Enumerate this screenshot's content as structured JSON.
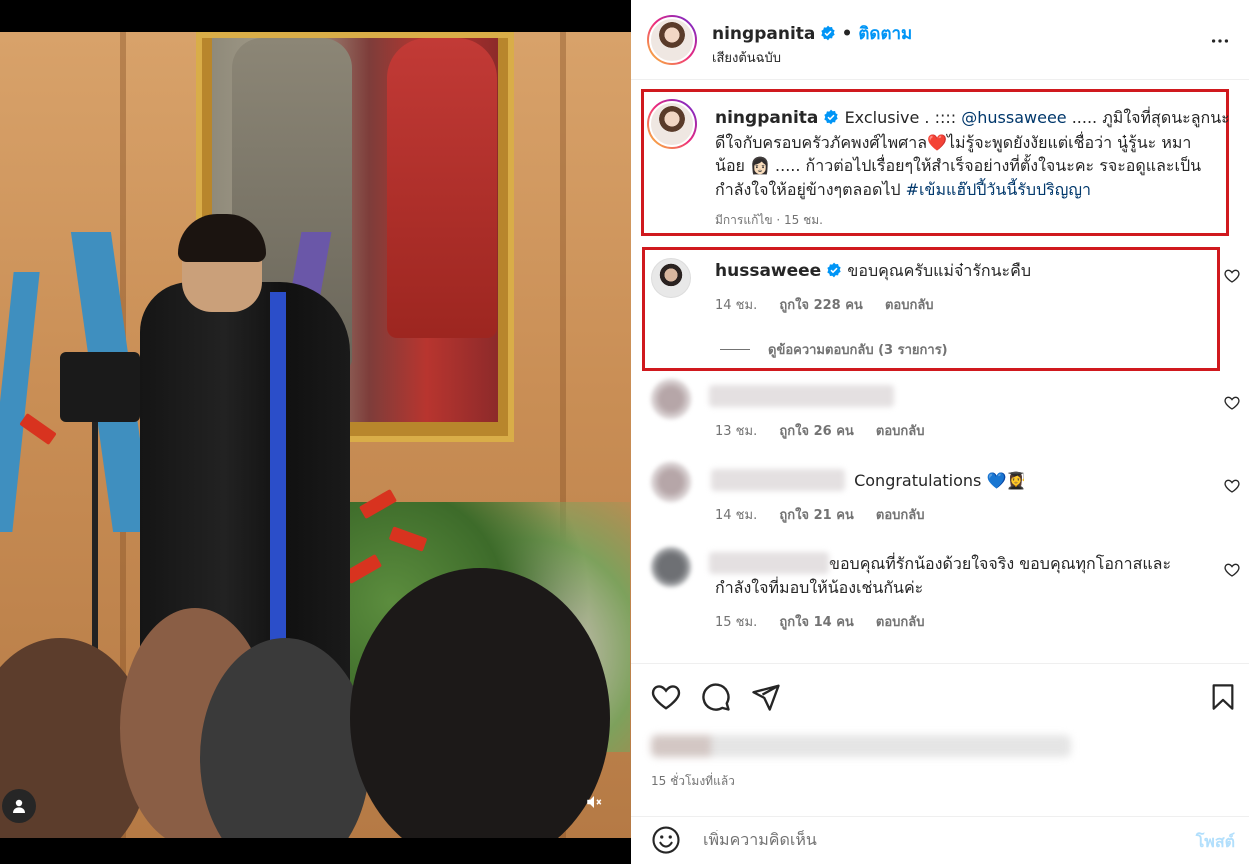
{
  "post": {
    "author": "ningpanita",
    "follow_label": "ติดตาม",
    "subtitle": "เสียงต้นฉบับ",
    "caption": {
      "username": "ningpanita",
      "line1_pre": "Exclusive . :::: ",
      "mention": "@hussaweee",
      "line1_post": " ..... ภูมิใจที่สุดนะลูกนะ",
      "line2_pre": "ดีใจกับครอบครัวภัคพงศ์ไพศาล",
      "line2_emoji": "❤️",
      "line2_post": "ไม่รู้จะพูดยังงัยแต่เชื่อว่า นู๋รู้นะ หมา",
      "line3_pre": "น้อย ",
      "line3_emoji": "👩🏻",
      "line3_post": " ..... ก้าวต่อไปเรื่อยๆให้สำเร็จอย่างที่ตั้งใจนะคะ รจะอดูและเป็น",
      "line4_pre": "กำลังใจให้อยู่ข้างๆตลอดไป ",
      "hashtag": "#เข้มแฮ๊ปปี้วันนี้รับปริญญา",
      "meta": "มีการแก้ไข · 15 ชม."
    },
    "comments": [
      {
        "username": "hussaweee",
        "text": "ขอบคุณครับแม่จ๋ารักนะคืบ",
        "time": "14 ชม.",
        "likes": "ถูกใจ 228 คน",
        "reply": "ตอบกลับ",
        "view_replies": "ดูข้อความตอบกลับ (3 รายการ)"
      },
      {
        "username": "",
        "text": "",
        "time": "13 ชม.",
        "likes": "ถูกใจ 26 คน",
        "reply": "ตอบกลับ"
      },
      {
        "username": "",
        "text": "Congratulations 💙👩‍🎓",
        "time": "14 ชม.",
        "likes": "ถูกใจ 21 คน",
        "reply": "ตอบกลับ"
      },
      {
        "username": "",
        "text_line1": "ขอบคุณที่รักน้องด้วยใจจริง ขอบคุณทุกโอกาสและ",
        "text_line2": "กำลังใจที่มอบให้น้องเช่นกันค่ะ",
        "time": "15 ชม.",
        "likes": "ถูกใจ 14 คน",
        "reply": "ตอบกลับ"
      }
    ],
    "time_ago": "15 ชั่วโมงที่แล้ว",
    "comment_placeholder": "เพิ่มความคิดเห็น",
    "post_label": "โพสต์"
  },
  "icons": {
    "verified": "verified-badge-icon",
    "more": "more-options-icon",
    "heart": "heart-icon",
    "comment": "comment-icon",
    "share": "share-icon",
    "save": "bookmark-icon",
    "emoji": "emoji-icon",
    "mute": "muted-speaker-icon",
    "user": "user-tag-icon"
  },
  "colors": {
    "accent": "#0095f6",
    "link": "#00376b",
    "highlight_border": "#d0191e",
    "verified": "#0095f6"
  }
}
